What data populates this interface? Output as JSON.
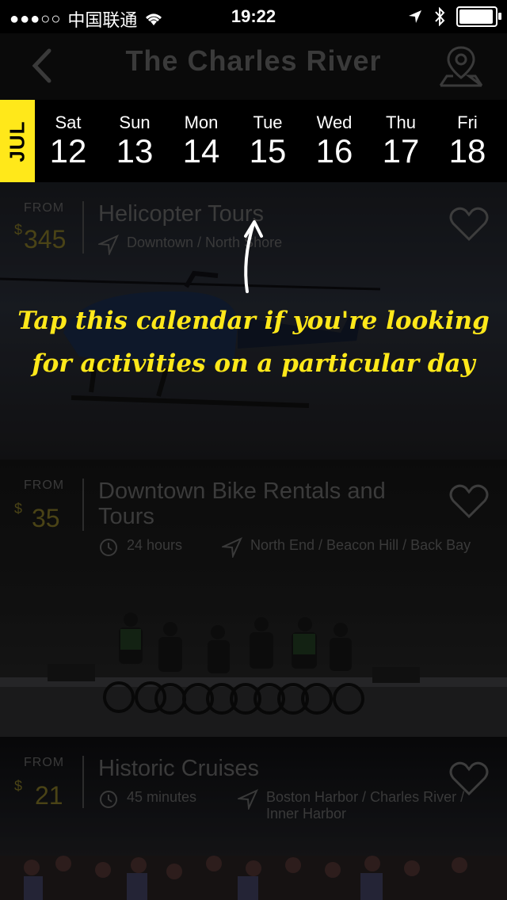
{
  "status_bar": {
    "signal_dots": "●●●○○",
    "carrier": "中国联通",
    "wifi_icon": "wifi-icon",
    "time": "19:22",
    "location_icon": "location-arrow-icon",
    "bluetooth_icon": "bluetooth-icon",
    "battery_level": 0.95
  },
  "nav": {
    "title": "The Charles River",
    "back_icon": "chevron-left-icon",
    "map_icon": "map-pin-icon"
  },
  "calendar": {
    "month": "JUL",
    "days": [
      {
        "name": "Sat",
        "num": "12"
      },
      {
        "name": "Sun",
        "num": "13"
      },
      {
        "name": "Mon",
        "num": "14"
      },
      {
        "name": "Tue",
        "num": "15"
      },
      {
        "name": "Wed",
        "num": "16"
      },
      {
        "name": "Thu",
        "num": "17"
      },
      {
        "name": "Fri",
        "num": "18"
      }
    ]
  },
  "coach_mark": {
    "line1": "Tap this calendar if you're looking",
    "line2": "for activities on a particular day"
  },
  "activities": [
    {
      "from_label": "FROM",
      "currency": "$",
      "price": "345",
      "title": "Helicopter Tours",
      "duration": "",
      "location": "Downtown / North Shore"
    },
    {
      "from_label": "FROM",
      "currency": "$",
      "price": "35",
      "title": "Downtown Bike Rentals and Tours",
      "duration": "24 hours",
      "location": "North End / Beacon Hill / Back Bay"
    },
    {
      "from_label": "FROM",
      "currency": "$",
      "price": "21",
      "title": "Historic Cruises",
      "duration": "45 minutes",
      "location": "Boston Harbor / Charles River / Inner Harbor"
    }
  ],
  "colors": {
    "accent": "#ffe81a",
    "background": "#000000"
  }
}
